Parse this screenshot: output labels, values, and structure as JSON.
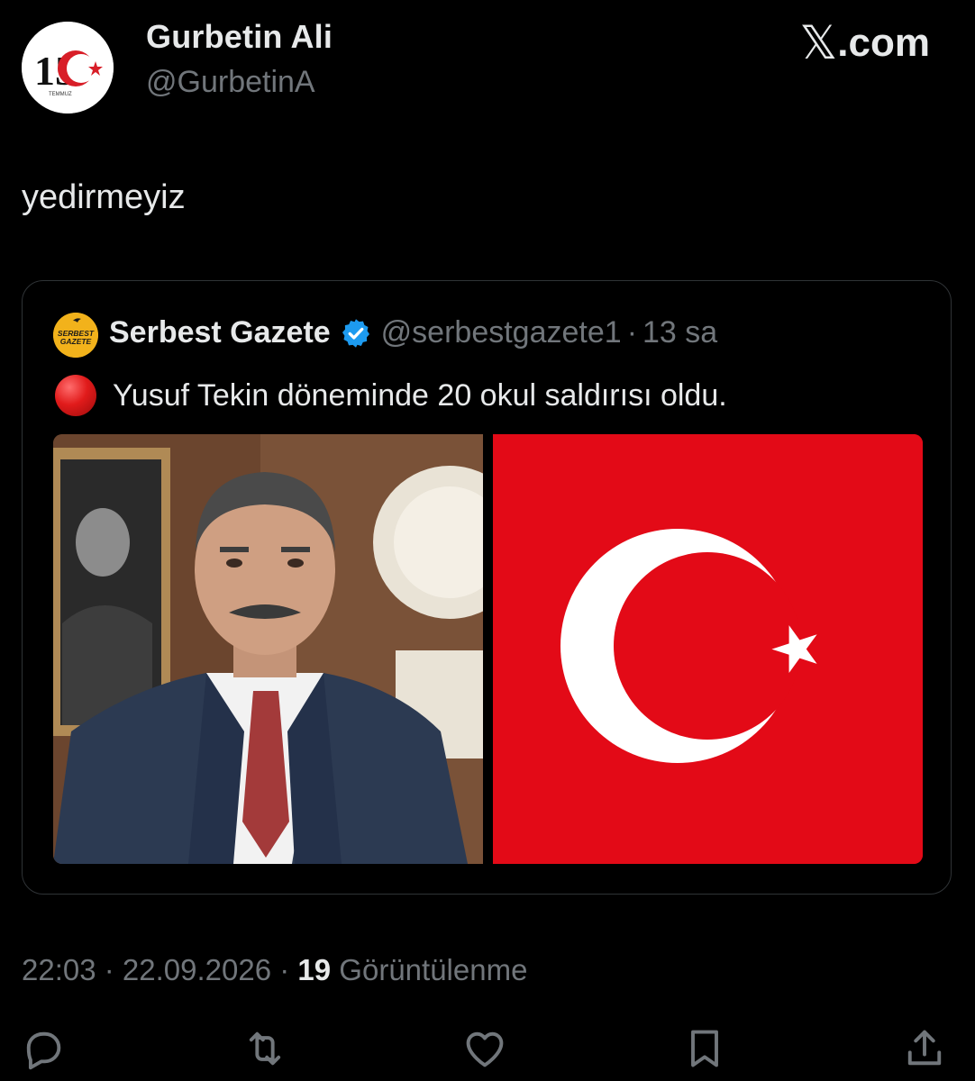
{
  "author": {
    "display_name": "Gurbetin Ali",
    "handle": "@GurbetinA",
    "avatar": {
      "icon": "15-temmuz-logo-icon",
      "number": "15",
      "caption": "TEMMUZ"
    }
  },
  "brand": {
    "logo_symbol": "𝕏",
    "logo_text": ".com"
  },
  "tweet": {
    "text": "yedirmeyiz"
  },
  "quoted_tweet": {
    "avatar": {
      "icon": "serbest-gazete-logo-icon",
      "line1": "SERBEST",
      "line2": "GAZETE"
    },
    "name": "Serbest Gazete",
    "verified_icon": "verified-badge-icon",
    "handle": "@serbestgazete1",
    "separator": "·",
    "time": "13 sa",
    "emoji_icon": "red-circle-icon",
    "text": "Yusuf Tekin döneminde 20 okul saldırısı oldu.",
    "media": [
      {
        "icon": "person-photo-icon"
      },
      {
        "icon": "turkish-flag-icon"
      }
    ]
  },
  "meta": {
    "time": "22:03",
    "sep1": " · ",
    "date": "22.09.2026",
    "sep2": " · ",
    "views_count": "19",
    "views_label": " Görüntülenme"
  },
  "actions": [
    {
      "icon": "reply-icon"
    },
    {
      "icon": "repost-icon"
    },
    {
      "icon": "like-icon"
    },
    {
      "icon": "bookmark-icon"
    },
    {
      "icon": "share-icon"
    }
  ],
  "colors": {
    "background": "#000000",
    "text": "#e7e9ea",
    "secondary": "#71767b",
    "border": "#2f3336",
    "verified": "#1d9bf0",
    "flag_red": "#e30a17"
  }
}
